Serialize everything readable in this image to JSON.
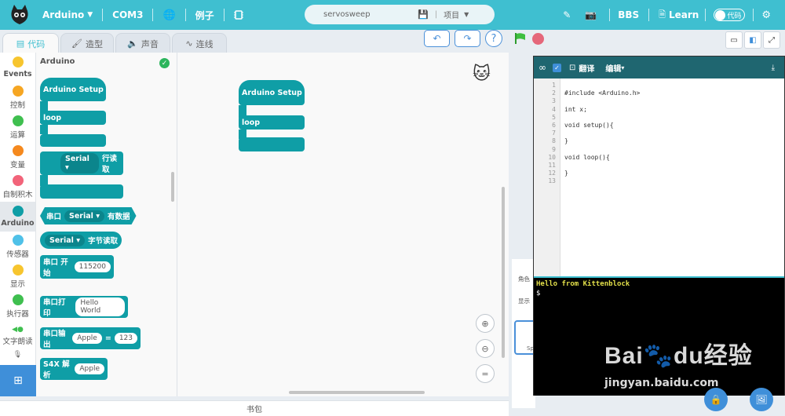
{
  "topbar": {
    "board": "Arduino",
    "port": "COM3",
    "examples": "例子",
    "project_name": "servosweep",
    "project_menu": "项目",
    "bbs": "BBS",
    "learn": "Learn",
    "code_toggle": "代码"
  },
  "tabs": [
    {
      "label": "代码"
    },
    {
      "label": "造型"
    },
    {
      "label": "声音"
    },
    {
      "label": "连线"
    }
  ],
  "categories": [
    {
      "label": "Events",
      "color": "#f7c52e"
    },
    {
      "label": "控制",
      "color": "#f6a623"
    },
    {
      "label": "运算",
      "color": "#3fbf4f"
    },
    {
      "label": "变量",
      "color": "#f5891e"
    },
    {
      "label": "自制积木",
      "color": "#f2647a"
    },
    {
      "label": "Arduino",
      "color": "#0f9ea6"
    },
    {
      "label": "传感器",
      "color": "#4fc1e8"
    },
    {
      "label": "显示",
      "color": "#f7c52e"
    },
    {
      "label": "执行器",
      "color": "#3fbf4f"
    },
    {
      "label": "文字朗读",
      "color": "#3fbf4f"
    }
  ],
  "palette": {
    "title": "Arduino",
    "setup_label": "Arduino Setup",
    "loop_label": "loop",
    "serial_read_line_dd": "Serial ▾",
    "serial_read_line_text": "行读取",
    "serial_available_prefix": "串口",
    "serial_available_dd": "Serial ▾",
    "serial_available_suffix": "有数据",
    "serial_read_byte_dd": "Serial ▾",
    "serial_read_byte_text": "字节读取",
    "serial_begin_text": "串口 开始",
    "serial_begin_value": "115200",
    "serial_print_text": "串口打印",
    "serial_print_value": "Hello World",
    "serial_output_text": "串口输出",
    "serial_output_key": "Apple",
    "serial_output_eq": "=",
    "serial_output_value": "123",
    "s4x_text": "S4X 解析",
    "s4x_value": "Apple"
  },
  "workspace": {
    "setup_label": "Arduino Setup",
    "loop_label": "loop"
  },
  "stage_panel": {
    "sprite_label": "角色",
    "show_label": "显示",
    "sprite_thumb": "Sp"
  },
  "code_panel": {
    "translate": "翻译",
    "edit": "编辑",
    "line_numbers": [
      "1",
      "2",
      "3",
      "4",
      "5",
      "6",
      "7",
      "8",
      "9",
      "10",
      "11",
      "12",
      "13"
    ],
    "lines": [
      "",
      "#include <Arduino.h>",
      "",
      "int x;",
      "",
      "void setup(){",
      "",
      "}",
      "",
      "void loop(){",
      "",
      "}",
      ""
    ],
    "console_line1": "Hello from Kittenblock",
    "console_line2": "$"
  },
  "backpack": "书包",
  "watermark": {
    "main": "Bai🐾du经验",
    "sub": "jingyan.baidu.com"
  }
}
